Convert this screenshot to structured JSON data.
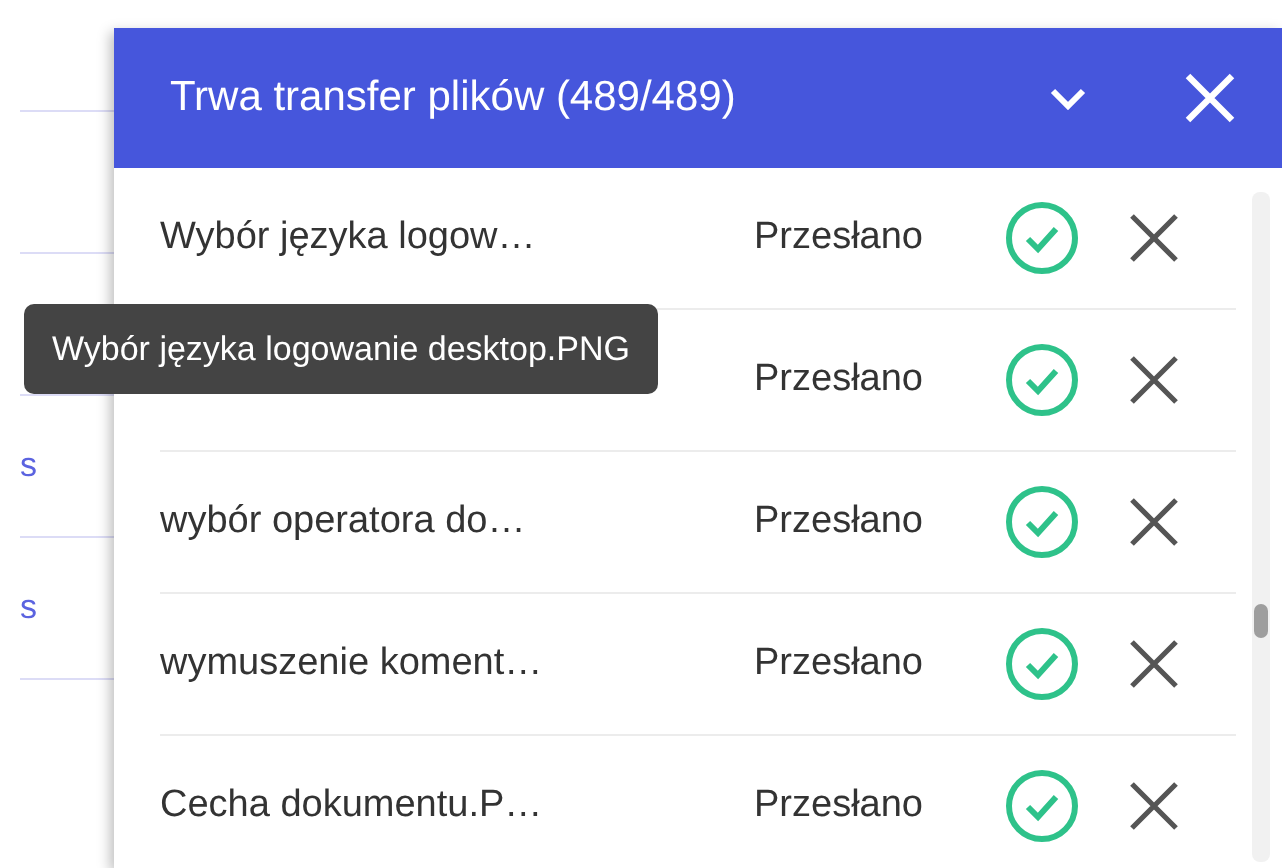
{
  "background": {
    "links": [
      "s",
      "s"
    ]
  },
  "panel": {
    "title": "Trwa transfer plików (489/489)"
  },
  "files": [
    {
      "name": "Wybór języka logow…",
      "status": "Przesłano"
    },
    {
      "status": "Przesłano"
    },
    {
      "name": "wybór operatora do…",
      "status": "Przesłano"
    },
    {
      "name": "wymuszenie koment…",
      "status": "Przesłano"
    },
    {
      "name": "Cecha dokumentu.P…",
      "status": "Przesłano"
    }
  ],
  "tooltip": "Wybór języka logowanie desktop.PNG"
}
